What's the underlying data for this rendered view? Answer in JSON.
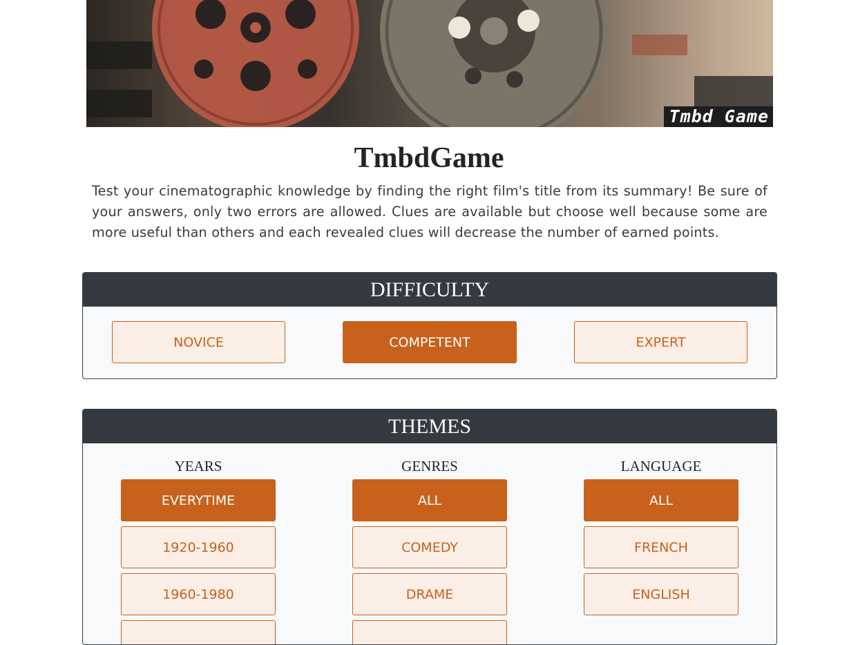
{
  "banner": {
    "caption": "Tmbd Game"
  },
  "title": "TmbdGame",
  "intro": "Test your cinematographic knowledge by finding the right film's title from its summary! Be sure of your answers, only two errors are allowed. Clues are available but choose well because some are more useful than others and each revealed clues will decrease the number of earned points.",
  "difficulty": {
    "header": "DIFFICULTY",
    "options": [
      "NOVICE",
      "COMPETENT",
      "EXPERT"
    ],
    "selected": "COMPETENT"
  },
  "themes": {
    "header": "THEMES",
    "years": {
      "label": "YEARS",
      "options": [
        "EVERYTIME",
        "1920-1960",
        "1960-1980"
      ],
      "selected": "EVERYTIME"
    },
    "genres": {
      "label": "GENRES",
      "options": [
        "ALL",
        "COMEDY",
        "DRAME"
      ],
      "selected": "ALL"
    },
    "language": {
      "label": "LANGUAGE",
      "options": [
        "ALL",
        "FRENCH",
        "ENGLISH"
      ],
      "selected": "ALL"
    }
  },
  "colors": {
    "accent": "#c8611c",
    "accent_light": "#faeee6",
    "header_bg": "#343a40"
  }
}
